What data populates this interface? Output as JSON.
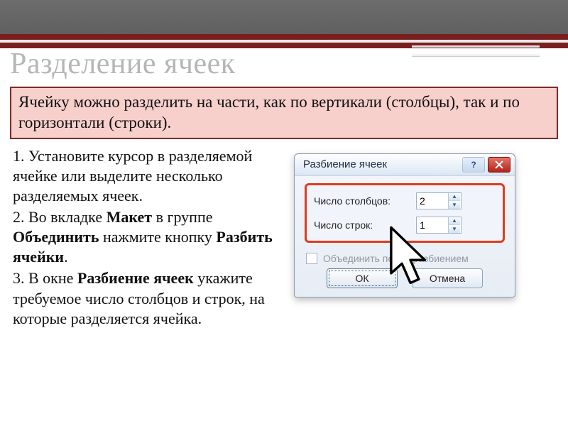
{
  "title": "Разделение ячеек",
  "intro": "Ячейку можно разделить на части, как по вертикали (столбцы), так и по горизонтали (строки).",
  "steps": {
    "s1": "1. Установите курсор в разделяемой ячейке или выделите несколько разделяемых ячеек.",
    "s2_pre": "2. Во вкладке ",
    "s2_b1": "Макет",
    "s2_mid": " в группе ",
    "s2_b2": "Объединить",
    "s2_mid2": " нажмите кнопку ",
    "s2_b3": "Разбить ячейки",
    "s2_post": ".",
    "s3_pre": "3. В окне ",
    "s3_b1": "Разбиение ячеек",
    "s3_post": "  укажите требуемое число столбцов и строк, на которые разделяется ячейка."
  },
  "dialog": {
    "title": "Разбиение ячеек",
    "help": "?",
    "cols_label": "Число столбцов:",
    "rows_label": "Число строк:",
    "cols_value": "2",
    "rows_value": "1",
    "merge_label": "Объединить перед разбиением",
    "ok": "ОК",
    "cancel": "Отмена"
  }
}
